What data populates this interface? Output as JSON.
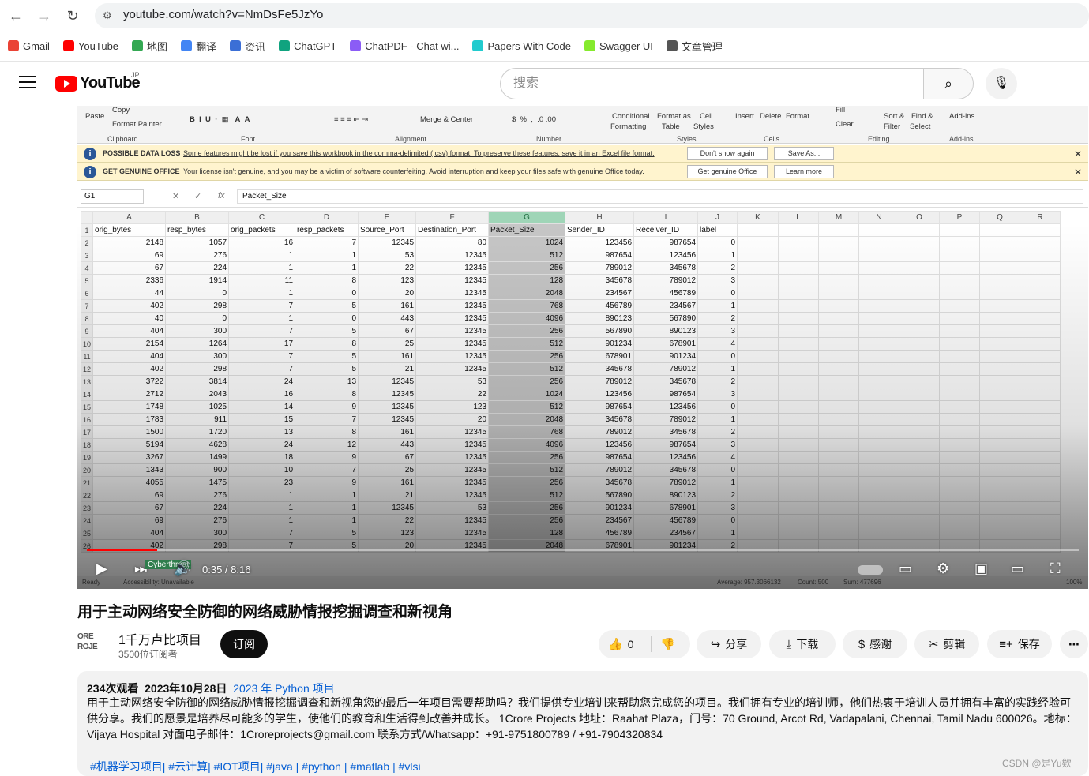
{
  "browser": {
    "url": "youtube.com/watch?v=NmDsFe5JzYo",
    "bookmarks": [
      {
        "label": "Gmail",
        "color": "#ea4335"
      },
      {
        "label": "YouTube",
        "color": "#ff0000"
      },
      {
        "label": "地图",
        "color": "#34a853"
      },
      {
        "label": "翻译",
        "color": "#4285f4"
      },
      {
        "label": "资讯",
        "color": "#3b6fd6"
      },
      {
        "label": "ChatGPT",
        "color": "#10a37f"
      },
      {
        "label": "ChatPDF - Chat wi...",
        "color": "#8b5cf6"
      },
      {
        "label": "Papers With Code",
        "color": "#21cbce"
      },
      {
        "label": "Swagger UI",
        "color": "#85ea2d"
      },
      {
        "label": "文章管理",
        "color": "#555555"
      }
    ]
  },
  "yt": {
    "logo": "YouTube",
    "region": "JP",
    "search_placeholder": "搜索"
  },
  "excel": {
    "ribbon": {
      "paste": "Paste",
      "copy": "Copy",
      "format_painter": "Format Painter",
      "merge_center": "Merge & Center",
      "conditional_formatting_1": "Conditional",
      "conditional_formatting_2": "Formatting",
      "format_as_table_1": "Format as",
      "format_as_table_2": "Table",
      "cell_styles_1": "Cell",
      "cell_styles_2": "Styles",
      "insert": "Insert",
      "delete": "Delete",
      "format": "Format",
      "fill": "Fill",
      "clear": "Clear",
      "sort_filter_1": "Sort &",
      "sort_filter_2": "Filter",
      "find_select_1": "Find &",
      "find_select_2": "Select",
      "add_ins": "Add-ins",
      "groups": {
        "clipboard": "Clipboard",
        "font": "Font",
        "alignment": "Alignment",
        "number": "Number",
        "styles": "Styles",
        "cells": "Cells",
        "editing": "Editing",
        "add_ins": "Add-ins"
      }
    },
    "msg1": {
      "title": "POSSIBLE DATA LOSS",
      "text": "Some features might be lost if you save this workbook in the comma-delimited (.csv) format. To preserve these features, save it in an Excel file format.",
      "btn1": "Don't show again",
      "btn2": "Save As..."
    },
    "msg2": {
      "title": "GET GENUINE OFFICE",
      "text": "Your license isn't genuine, and you may be a victim of software counterfeiting. Avoid interruption and keep your files safe with genuine Office today.",
      "btn1": "Get genuine Office",
      "btn2": "Learn more"
    },
    "name_box": "G1",
    "formula": "Packet_Size",
    "columns": [
      "A",
      "B",
      "C",
      "D",
      "E",
      "F",
      "G",
      "H",
      "I",
      "J",
      "K",
      "L",
      "M",
      "N",
      "O",
      "P",
      "Q",
      "R"
    ],
    "headers": [
      "orig_bytes",
      "resp_bytes",
      "orig_packets",
      "resp_packets",
      "Source_Port",
      "Destination_Port",
      "Packet_Size",
      "Sender_ID",
      "Receiver_ID",
      "label"
    ],
    "rows": [
      [
        2148,
        1057,
        16,
        7,
        12345,
        80,
        1024,
        123456,
        987654,
        0
      ],
      [
        69,
        276,
        1,
        1,
        53,
        12345,
        512,
        987654,
        123456,
        1
      ],
      [
        67,
        224,
        1,
        1,
        22,
        12345,
        256,
        789012,
        345678,
        2
      ],
      [
        2336,
        1914,
        11,
        8,
        123,
        12345,
        128,
        345678,
        789012,
        3
      ],
      [
        44,
        0,
        1,
        0,
        20,
        12345,
        2048,
        234567,
        456789,
        0
      ],
      [
        402,
        298,
        7,
        5,
        161,
        12345,
        768,
        456789,
        234567,
        1
      ],
      [
        40,
        0,
        1,
        0,
        443,
        12345,
        4096,
        890123,
        567890,
        2
      ],
      [
        404,
        300,
        7,
        5,
        67,
        12345,
        256,
        567890,
        890123,
        3
      ],
      [
        2154,
        1264,
        17,
        8,
        25,
        12345,
        512,
        901234,
        678901,
        4
      ],
      [
        404,
        300,
        7,
        5,
        161,
        12345,
        256,
        678901,
        901234,
        0
      ],
      [
        402,
        298,
        7,
        5,
        21,
        12345,
        512,
        345678,
        789012,
        1
      ],
      [
        3722,
        3814,
        24,
        13,
        12345,
        53,
        256,
        789012,
        345678,
        2
      ],
      [
        2712,
        2043,
        16,
        8,
        12345,
        22,
        1024,
        123456,
        987654,
        3
      ],
      [
        1748,
        1025,
        14,
        9,
        12345,
        123,
        512,
        987654,
        123456,
        0
      ],
      [
        1783,
        911,
        15,
        7,
        12345,
        20,
        2048,
        345678,
        789012,
        1
      ],
      [
        1500,
        1720,
        13,
        8,
        161,
        12345,
        768,
        789012,
        345678,
        2
      ],
      [
        5194,
        4628,
        24,
        12,
        443,
        12345,
        4096,
        123456,
        987654,
        3
      ],
      [
        3267,
        1499,
        18,
        9,
        67,
        12345,
        256,
        987654,
        123456,
        4
      ],
      [
        1343,
        900,
        10,
        7,
        25,
        12345,
        512,
        789012,
        345678,
        0
      ],
      [
        4055,
        1475,
        23,
        9,
        161,
        12345,
        256,
        345678,
        789012,
        1
      ],
      [
        69,
        276,
        1,
        1,
        21,
        12345,
        512,
        567890,
        890123,
        2
      ],
      [
        67,
        224,
        1,
        1,
        12345,
        53,
        256,
        901234,
        678901,
        3
      ],
      [
        69,
        276,
        1,
        1,
        22,
        12345,
        256,
        234567,
        456789,
        0
      ],
      [
        404,
        300,
        7,
        5,
        123,
        12345,
        128,
        456789,
        234567,
        1
      ],
      [
        402,
        298,
        7,
        5,
        20,
        12345,
        2048,
        678901,
        901234,
        2
      ]
    ],
    "status_ready": "Ready",
    "status_accessibility": "Accessibility: Unavailable",
    "sheet_tab": "Cyberthreat",
    "status_average": "Average: 957.3066132",
    "status_count": "Count: 500",
    "status_sum": "Sum: 477696",
    "zoom": "100%"
  },
  "player": {
    "current_time": "0:35",
    "duration": "8:16",
    "progress_fraction": 0.0706
  },
  "video": {
    "title": "用于主动网络安全防御的网络威胁情报挖掘调查和新视角",
    "channel_avatar_text_1": "ORE",
    "channel_avatar_text_2": "ROJE",
    "channel": "1千万卢比项目",
    "subscribers": "3500位订阅者",
    "subscribe": "订阅",
    "likes": "0",
    "share": "分享",
    "download": "下载",
    "thanks": "感谢",
    "clip": "剪辑",
    "save": "保存",
    "more": "⋯",
    "views": "234次观看",
    "date": "2023年10月28日",
    "category_link": "2023 年 Python 项目",
    "description": "用于主动网络安全防御的网络威胁情报挖掘调查和新视角您的最后一年项目需要帮助吗？我们提供专业培训来帮助您完成您的项目。我们拥有专业的培训师，他们热衷于培训人员并拥有丰富的实践经验可供分享。我们的愿景是培养尽可能多的学生，使他们的教育和生活得到改善并成长。 1Crore Projects 地址：Raahat Plaza，门号：70 Ground, Arcot Rd, Vadapalani, Chennai, Tamil Nadu 600026。地标：Vijaya Hospital 对面电子邮件：1Croreprojects@gmail.com 联系方式/Whatsapp：+91-9751800789 / +91-7904320834",
    "tags": "#机器学习项目| #云计算| #IOT项目| #java | #python | #matlab | #vlsi"
  },
  "watermark": "CSDN @是Yu欸"
}
